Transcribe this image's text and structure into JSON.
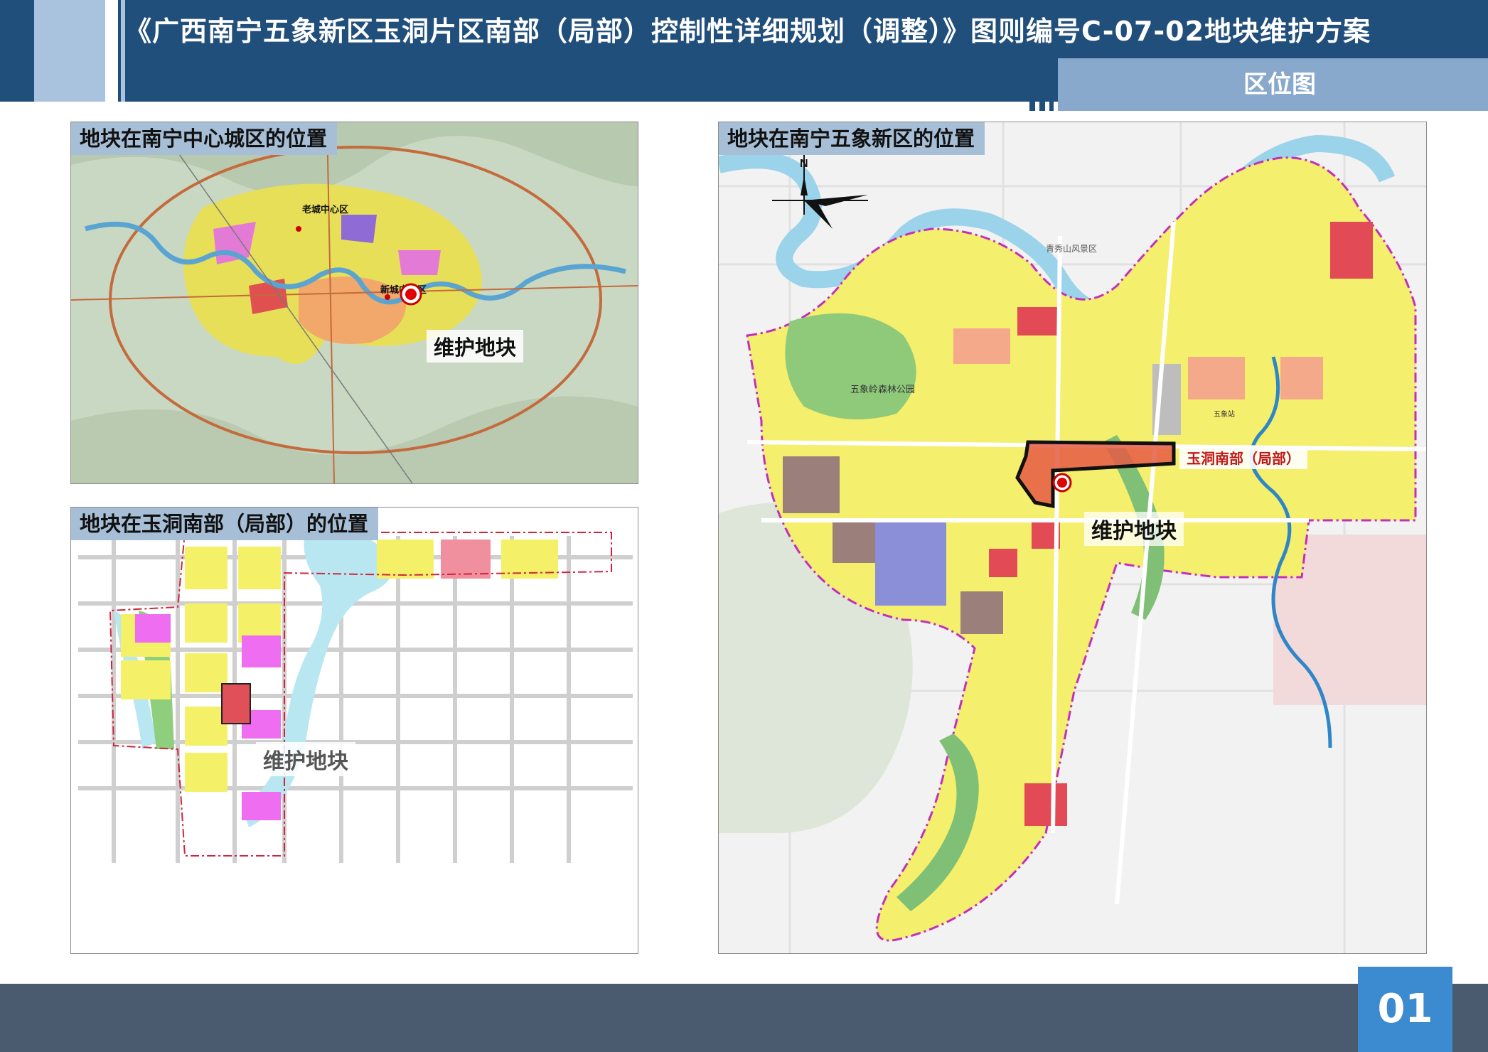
{
  "header": {
    "title": "《广西南宁五象新区玉洞片区南部（局部）控制性详细规划（调整）》图则编号C-07-02地块维护方案",
    "subtitle": "区位图",
    "colors": {
      "band": "#214f7b",
      "subtitle_box": "#89a9cc",
      "stripe": "#a9c3de"
    }
  },
  "panels": {
    "city": {
      "label": "地块在南宁中心城区的位置",
      "place_labels": [
        "老城中心区",
        "新城中心区"
      ],
      "callout": "维护地块"
    },
    "local": {
      "label": "地块在玉洞南部（局部）的位置",
      "callout": "维护地块"
    },
    "district": {
      "label": "地块在南宁五象新区的位置",
      "north": "N",
      "place_labels": [
        "五象岭森林公园",
        "五象站",
        "青秀山风景区"
      ],
      "area_label": "玉洞南部（局部）",
      "callout": "维护地块"
    }
  },
  "footer": {
    "page_number": "01"
  }
}
